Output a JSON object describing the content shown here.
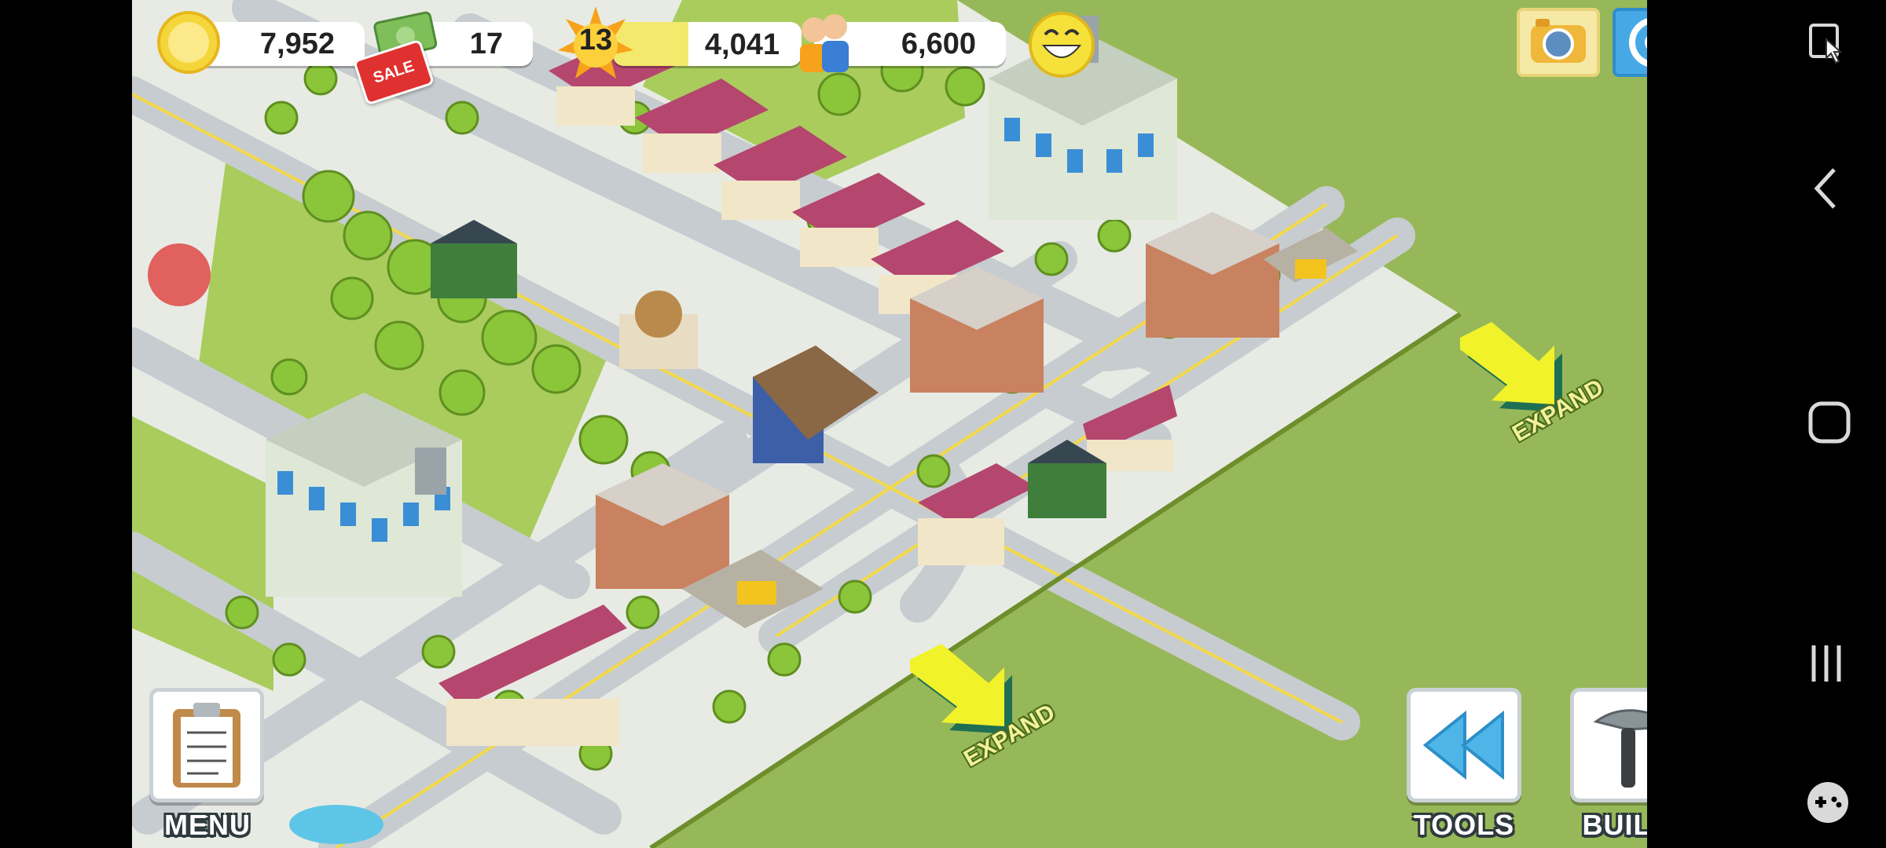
{
  "hud": {
    "coins": "7,952",
    "cash": "17",
    "sale_tag": "SALE",
    "level": "13",
    "xp": "4,041",
    "xp_fraction": 0.4,
    "population": "6,600",
    "happiness_icon": "smiley-face-icon"
  },
  "corner_buttons": {
    "camera_icon": "camera-icon",
    "social_icon": "social-share-icon"
  },
  "bottom_buttons": {
    "menu_label": "MENU",
    "tools_label": "TOOLS",
    "build_label": "BUILD"
  },
  "expand": {
    "right_label": "EXPAND",
    "bottom_label": "EXPAND"
  },
  "android_nav": {
    "screenshot_icon": "screenshot-edit-icon",
    "back_icon": "back-icon",
    "home_icon": "home-icon",
    "recents_icon": "recents-icon",
    "game_tools_icon": "game-controller-icon"
  },
  "colors": {
    "grass": "#97b858",
    "road": "#c7ccd0",
    "roof_pink": "#b5466e",
    "building_green": "#8fbf6a",
    "arrow_yellow": "#f2f22a",
    "expand_text": "#f1f29a"
  }
}
